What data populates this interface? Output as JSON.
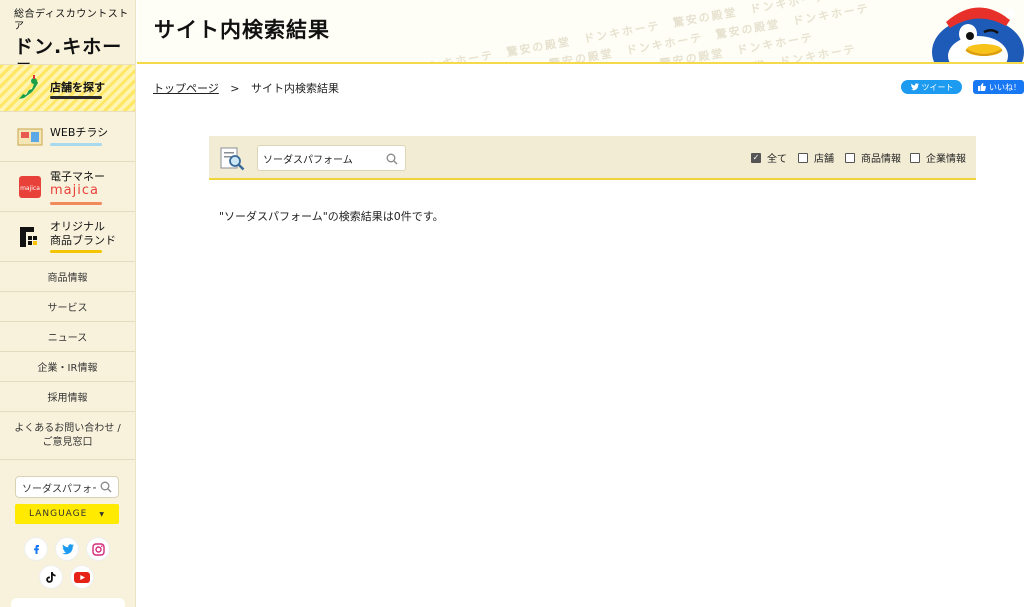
{
  "logo": {
    "tagline": "総合ディスカウントストア",
    "brand": "ドン.キホーテ"
  },
  "sidebar": {
    "store_search": "店舗を探す",
    "promos": [
      {
        "label": "WEBチラシ",
        "accent": "#a9d9ee",
        "icon": "flyer-icon"
      },
      {
        "label": "電子マネー",
        "sub": "majica",
        "accent": "#f08a5a",
        "icon": "majica-card-icon"
      },
      {
        "label": "オリジナル",
        "sub": "商品ブランド",
        "accent": "#f5c400",
        "icon": "brand-logo-icon"
      }
    ],
    "nav": [
      "商品情報",
      "サービス",
      "ニュース",
      "企業・IR情報",
      "採用情報"
    ],
    "contact_line1": "よくあるお問い合わせ /",
    "contact_line2": "ご意見窓口",
    "search_value": "ソーダスパフォー",
    "language": "LANGUAGE",
    "social": [
      "facebook-icon",
      "twitter-icon",
      "instagram-icon",
      "tiktok-icon",
      "youtube-icon"
    ]
  },
  "header": {
    "title": "サイト内検索結果",
    "pattern_text": "ドンキホーテ　驚安の殿堂　ドンキホーテ　驚安の殿堂　ドンキホーテ",
    "accent": "#f4d94a"
  },
  "breadcrumb": {
    "home": "トップページ",
    "separator": ">",
    "current": "サイト内検索結果"
  },
  "share": {
    "tweet": "ツイート",
    "like": "いいね！"
  },
  "search": {
    "value": "ソーダスパフォーム",
    "filters": [
      {
        "label": "全て",
        "checked": true
      },
      {
        "label": "店舗",
        "checked": false
      },
      {
        "label": "商品情報",
        "checked": false
      },
      {
        "label": "企業情報",
        "checked": false
      }
    ]
  },
  "result": "\"ソーダスパフォーム\"の検索結果は0件です。"
}
